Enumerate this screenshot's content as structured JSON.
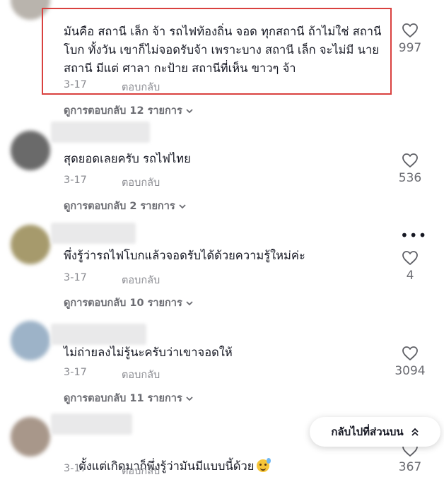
{
  "comments": [
    {
      "text": "มันคือ สถานี เล็ก จ้า รถไฟท้องถิ่น จอด ทุกสถานี ถ้าไม่ใช่ สถานี โบก ทั้งวัน เขาก็ไม่จอดรับจ้า เพราะบาง สถานี เล็ก จะไม่มี นายสถานี มีแต่ ศาลา กะป้าย สถานีที่เห็น ขาวๆ จ้า",
      "date": "3-17",
      "reply": "ตอบกลับ",
      "view_replies": "ดูการตอบกลับ 12 รายการ",
      "likes": "997"
    },
    {
      "text": "สุดยอดเลยครับ รถไฟไทย",
      "date": "3-17",
      "reply": "ตอบกลับ",
      "view_replies": "ดูการตอบกลับ 2 รายการ",
      "likes": "536"
    },
    {
      "text": "พึ่งรู้ว่ารถไฟโบกแล้วจอดรับได้ด้วยความรู้ใหม่ค่ะ",
      "date": "3-17",
      "reply": "ตอบกลับ",
      "view_replies": "ดูการตอบกลับ 10 รายการ",
      "likes": "4"
    },
    {
      "text": "ไม่ถ่ายลงไม่รู้นะครับว่าเขาจอดให้",
      "date": "3-17",
      "reply": "ตอบกลับ",
      "view_replies": "ดูการตอบกลับ 11 รายการ",
      "likes": "3094"
    },
    {
      "text": "ตั้งแต่เกิดมาก็พึ่งรู้ว่ามันมีแบบนี้ด้วย",
      "date": "3-17",
      "reply": "ตอบกลับ",
      "likes": "367"
    }
  ],
  "back_to_top": "กลับไปที่ส่วนบน",
  "more_menu": "•••",
  "colors": {
    "highlight_border": "#d9413f",
    "text": "#161823",
    "muted": "#8a8b91"
  }
}
